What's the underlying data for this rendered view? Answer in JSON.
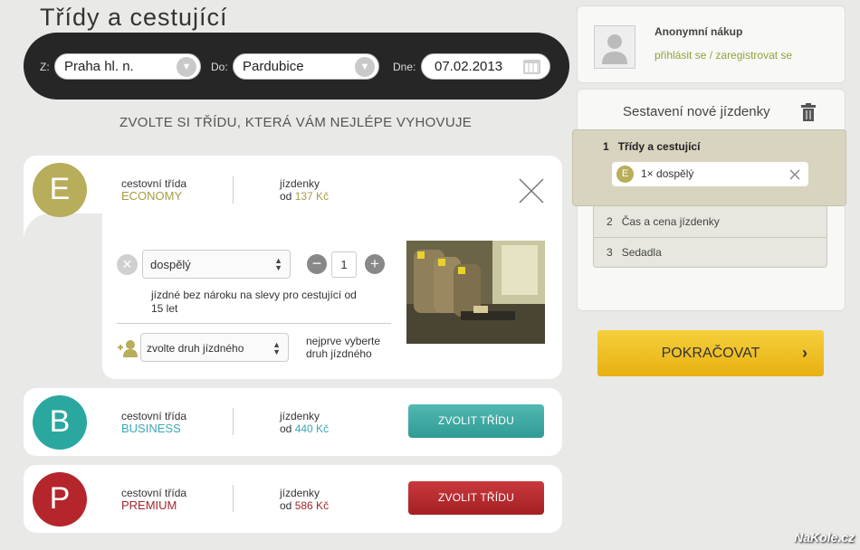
{
  "page": {
    "title": "Třídy a cestující",
    "subtitle": "ZVOLTE SI TŘÍDU, KTERÁ VÁM NEJLÉPE VYHOVUJE"
  },
  "search": {
    "from_label": "Z:",
    "from_value": "Praha hl. n.",
    "to_label": "Do:",
    "to_value": "Pardubice",
    "date_label": "Dne:",
    "date_value": "07.02.2013"
  },
  "classes": [
    {
      "letter": "E",
      "label": "cestovní třída",
      "name": "ECONOMY",
      "tickets_label": "jízdenky",
      "price_prefix": "od",
      "price": "137 Kč",
      "color": "#b7ad5a"
    },
    {
      "letter": "B",
      "label": "cestovní třída",
      "name": "BUSINESS",
      "tickets_label": "jízdenky",
      "price_prefix": "od",
      "price": "440 Kč",
      "button": "ZVOLIT TŘÍDU",
      "color": "#2aa8a0"
    },
    {
      "letter": "P",
      "label": "cestovní třída",
      "name": "PREMIUM",
      "tickets_label": "jízdenky",
      "price_prefix": "od",
      "price": "586 Kč",
      "button": "ZVOLIT TŘÍDU",
      "color": "#b5262c"
    }
  ],
  "economy_detail": {
    "passenger_type": "dospělý",
    "quantity": "1",
    "description": "jízdné bez nároku na slevy pro cestující od 15 let",
    "add_select": "zvolte druh jízdného",
    "add_hint": "nejprve vyberte druh jízdného"
  },
  "sidebar": {
    "user_title": "Anonymní nákup",
    "login_link": "přihlásit se",
    "separator": "/",
    "register_link": "zaregistrovat se",
    "ticket_title": "Sestavení nové jízdenky",
    "steps": [
      {
        "num": "1",
        "label": "Třídy a cestující"
      },
      {
        "num": "2",
        "label": "Čas a cena jízdenky"
      },
      {
        "num": "3",
        "label": "Sedadla"
      }
    ],
    "chip": {
      "letter": "E",
      "text": "1× dospělý"
    }
  },
  "continue_button": "POKRAČOVAT",
  "watermark": "NaKole.cz"
}
